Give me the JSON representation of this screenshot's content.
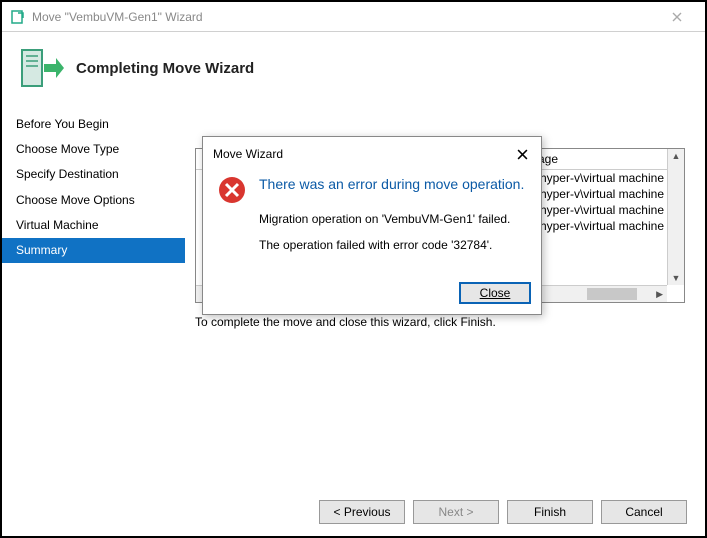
{
  "titlebar": {
    "text": "Move \"VembuVM-Gen1\" Wizard"
  },
  "header": {
    "title": "Completing Move Wizard"
  },
  "sidebar": {
    "items": [
      {
        "label": "Before You Begin"
      },
      {
        "label": "Choose Move Type"
      },
      {
        "label": "Specify Destination"
      },
      {
        "label": "Choose Move Options"
      },
      {
        "label": "Virtual Machine"
      },
      {
        "label": "Summary"
      }
    ],
    "selected_index": 5
  },
  "content": {
    "listing_header_col2": "Storage",
    "rows": [
      "olume1\\hyper-v\\virtual machine",
      "olume1\\hyper-v\\virtual machine",
      "olume1\\hyper-v\\virtual machine",
      "olume1\\hyper-v\\virtual machine"
    ],
    "hint": "To complete the move and close this wizard, click Finish."
  },
  "footer": {
    "previous": "< Previous",
    "next": "Next >",
    "finish": "Finish",
    "cancel": "Cancel"
  },
  "dialog": {
    "title": "Move Wizard",
    "heading": "There was an error during move operation.",
    "line1": "Migration operation on 'VembuVM-Gen1' failed.",
    "line2": "The operation failed with error code '32784'.",
    "close": "Close"
  },
  "colors": {
    "accent": "#1072c4",
    "link": "#0b5aa6"
  }
}
